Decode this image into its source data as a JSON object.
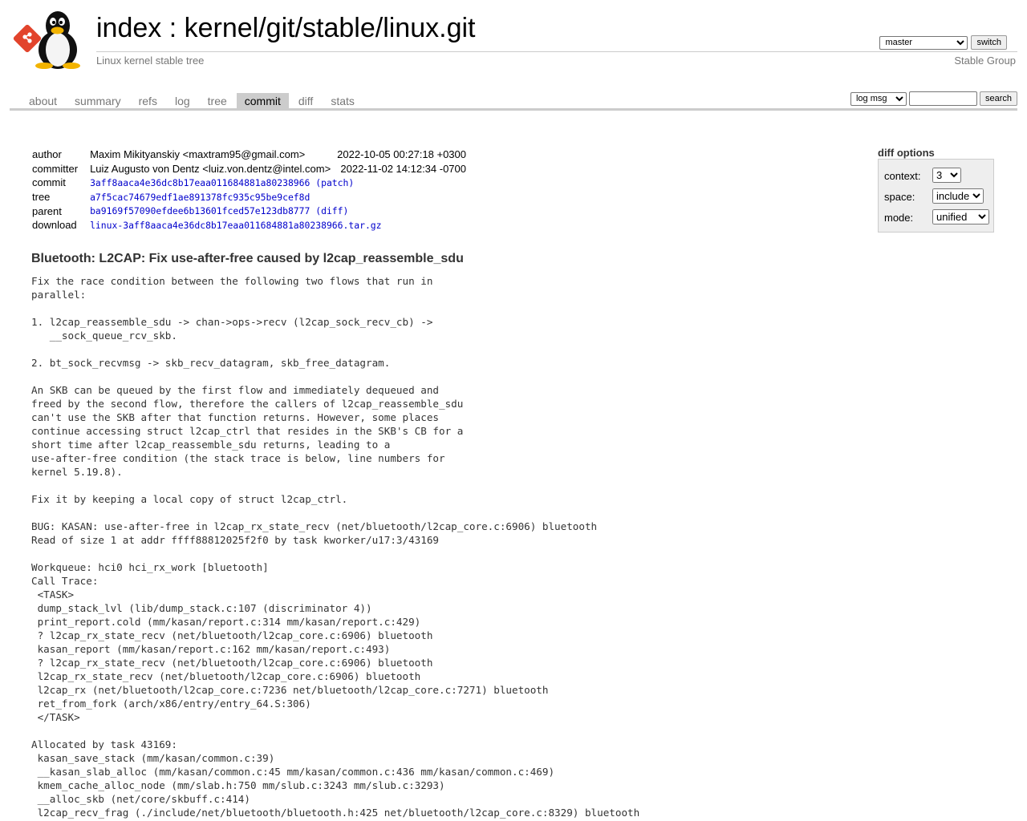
{
  "header": {
    "title_prefix": "index",
    "title_sep": " : ",
    "repo_path": "kernel/git/stable/linux.git",
    "description": "Linux kernel stable tree",
    "owner": "Stable Group",
    "branch_selected": "master",
    "switch_label": "switch"
  },
  "tabs": [
    {
      "label": "about"
    },
    {
      "label": "summary"
    },
    {
      "label": "refs"
    },
    {
      "label": "log"
    },
    {
      "label": "tree"
    },
    {
      "label": "commit",
      "active": true
    },
    {
      "label": "diff"
    },
    {
      "label": "stats"
    }
  ],
  "search": {
    "scope_selected": "log msg",
    "value": "",
    "button_label": "search"
  },
  "diff_options": {
    "title": "diff options",
    "context_label": "context:",
    "context_value": "3",
    "space_label": "space:",
    "space_value": "include",
    "mode_label": "mode:",
    "mode_value": "unified"
  },
  "commit_info": {
    "author_label": "author",
    "author": "Maxim Mikityanskiy <maxtram95@gmail.com>",
    "author_date": "2022-10-05 00:27:18 +0300",
    "committer_label": "committer",
    "committer": "Luiz Augusto von Dentz <luiz.von.dentz@intel.com>",
    "committer_date": "2022-11-02 14:12:34 -0700",
    "commit_label": "commit",
    "commit_sha": "3aff8aaca4e36dc8b17eaa011684881a80238966",
    "patch_link": "patch",
    "tree_label": "tree",
    "tree_sha": "a7f5cac74679edf1ae891378fc935c95be9cef8d",
    "parent_label": "parent",
    "parent_sha": "ba9169f57090efdee6b13601fced57e123db8777",
    "diff_link": "diff",
    "download_label": "download",
    "download_file": "linux-3aff8aaca4e36dc8b17eaa011684881a80238966.tar.gz"
  },
  "commit_subject": "Bluetooth: L2CAP: Fix use-after-free caused by l2cap_reassemble_sdu",
  "commit_message": "Fix the race condition between the following two flows that run in\nparallel:\n\n1. l2cap_reassemble_sdu -> chan->ops->recv (l2cap_sock_recv_cb) ->\n   __sock_queue_rcv_skb.\n\n2. bt_sock_recvmsg -> skb_recv_datagram, skb_free_datagram.\n\nAn SKB can be queued by the first flow and immediately dequeued and\nfreed by the second flow, therefore the callers of l2cap_reassemble_sdu\ncan't use the SKB after that function returns. However, some places\ncontinue accessing struct l2cap_ctrl that resides in the SKB's CB for a\nshort time after l2cap_reassemble_sdu returns, leading to a\nuse-after-free condition (the stack trace is below, line numbers for\nkernel 5.19.8).\n\nFix it by keeping a local copy of struct l2cap_ctrl.\n\nBUG: KASAN: use-after-free in l2cap_rx_state_recv (net/bluetooth/l2cap_core.c:6906) bluetooth\nRead of size 1 at addr ffff88812025f2f0 by task kworker/u17:3/43169\n\nWorkqueue: hci0 hci_rx_work [bluetooth]\nCall Trace:\n <TASK>\n dump_stack_lvl (lib/dump_stack.c:107 (discriminator 4))\n print_report.cold (mm/kasan/report.c:314 mm/kasan/report.c:429)\n ? l2cap_rx_state_recv (net/bluetooth/l2cap_core.c:6906) bluetooth\n kasan_report (mm/kasan/report.c:162 mm/kasan/report.c:493)\n ? l2cap_rx_state_recv (net/bluetooth/l2cap_core.c:6906) bluetooth\n l2cap_rx_state_recv (net/bluetooth/l2cap_core.c:6906) bluetooth\n l2cap_rx (net/bluetooth/l2cap_core.c:7236 net/bluetooth/l2cap_core.c:7271) bluetooth\n ret_from_fork (arch/x86/entry/entry_64.S:306)\n </TASK>\n\nAllocated by task 43169:\n kasan_save_stack (mm/kasan/common.c:39)\n __kasan_slab_alloc (mm/kasan/common.c:45 mm/kasan/common.c:436 mm/kasan/common.c:469)\n kmem_cache_alloc_node (mm/slab.h:750 mm/slub.c:3243 mm/slub.c:3293)\n __alloc_skb (net/core/skbuff.c:414)\n l2cap_recv_frag (./include/net/bluetooth/bluetooth.h:425 net/bluetooth/l2cap_core.c:8329) bluetooth",
  "colors": {
    "link": "#0000cc",
    "muted": "#777777",
    "tab_active_bg": "#cccccc",
    "text": "#333333"
  }
}
